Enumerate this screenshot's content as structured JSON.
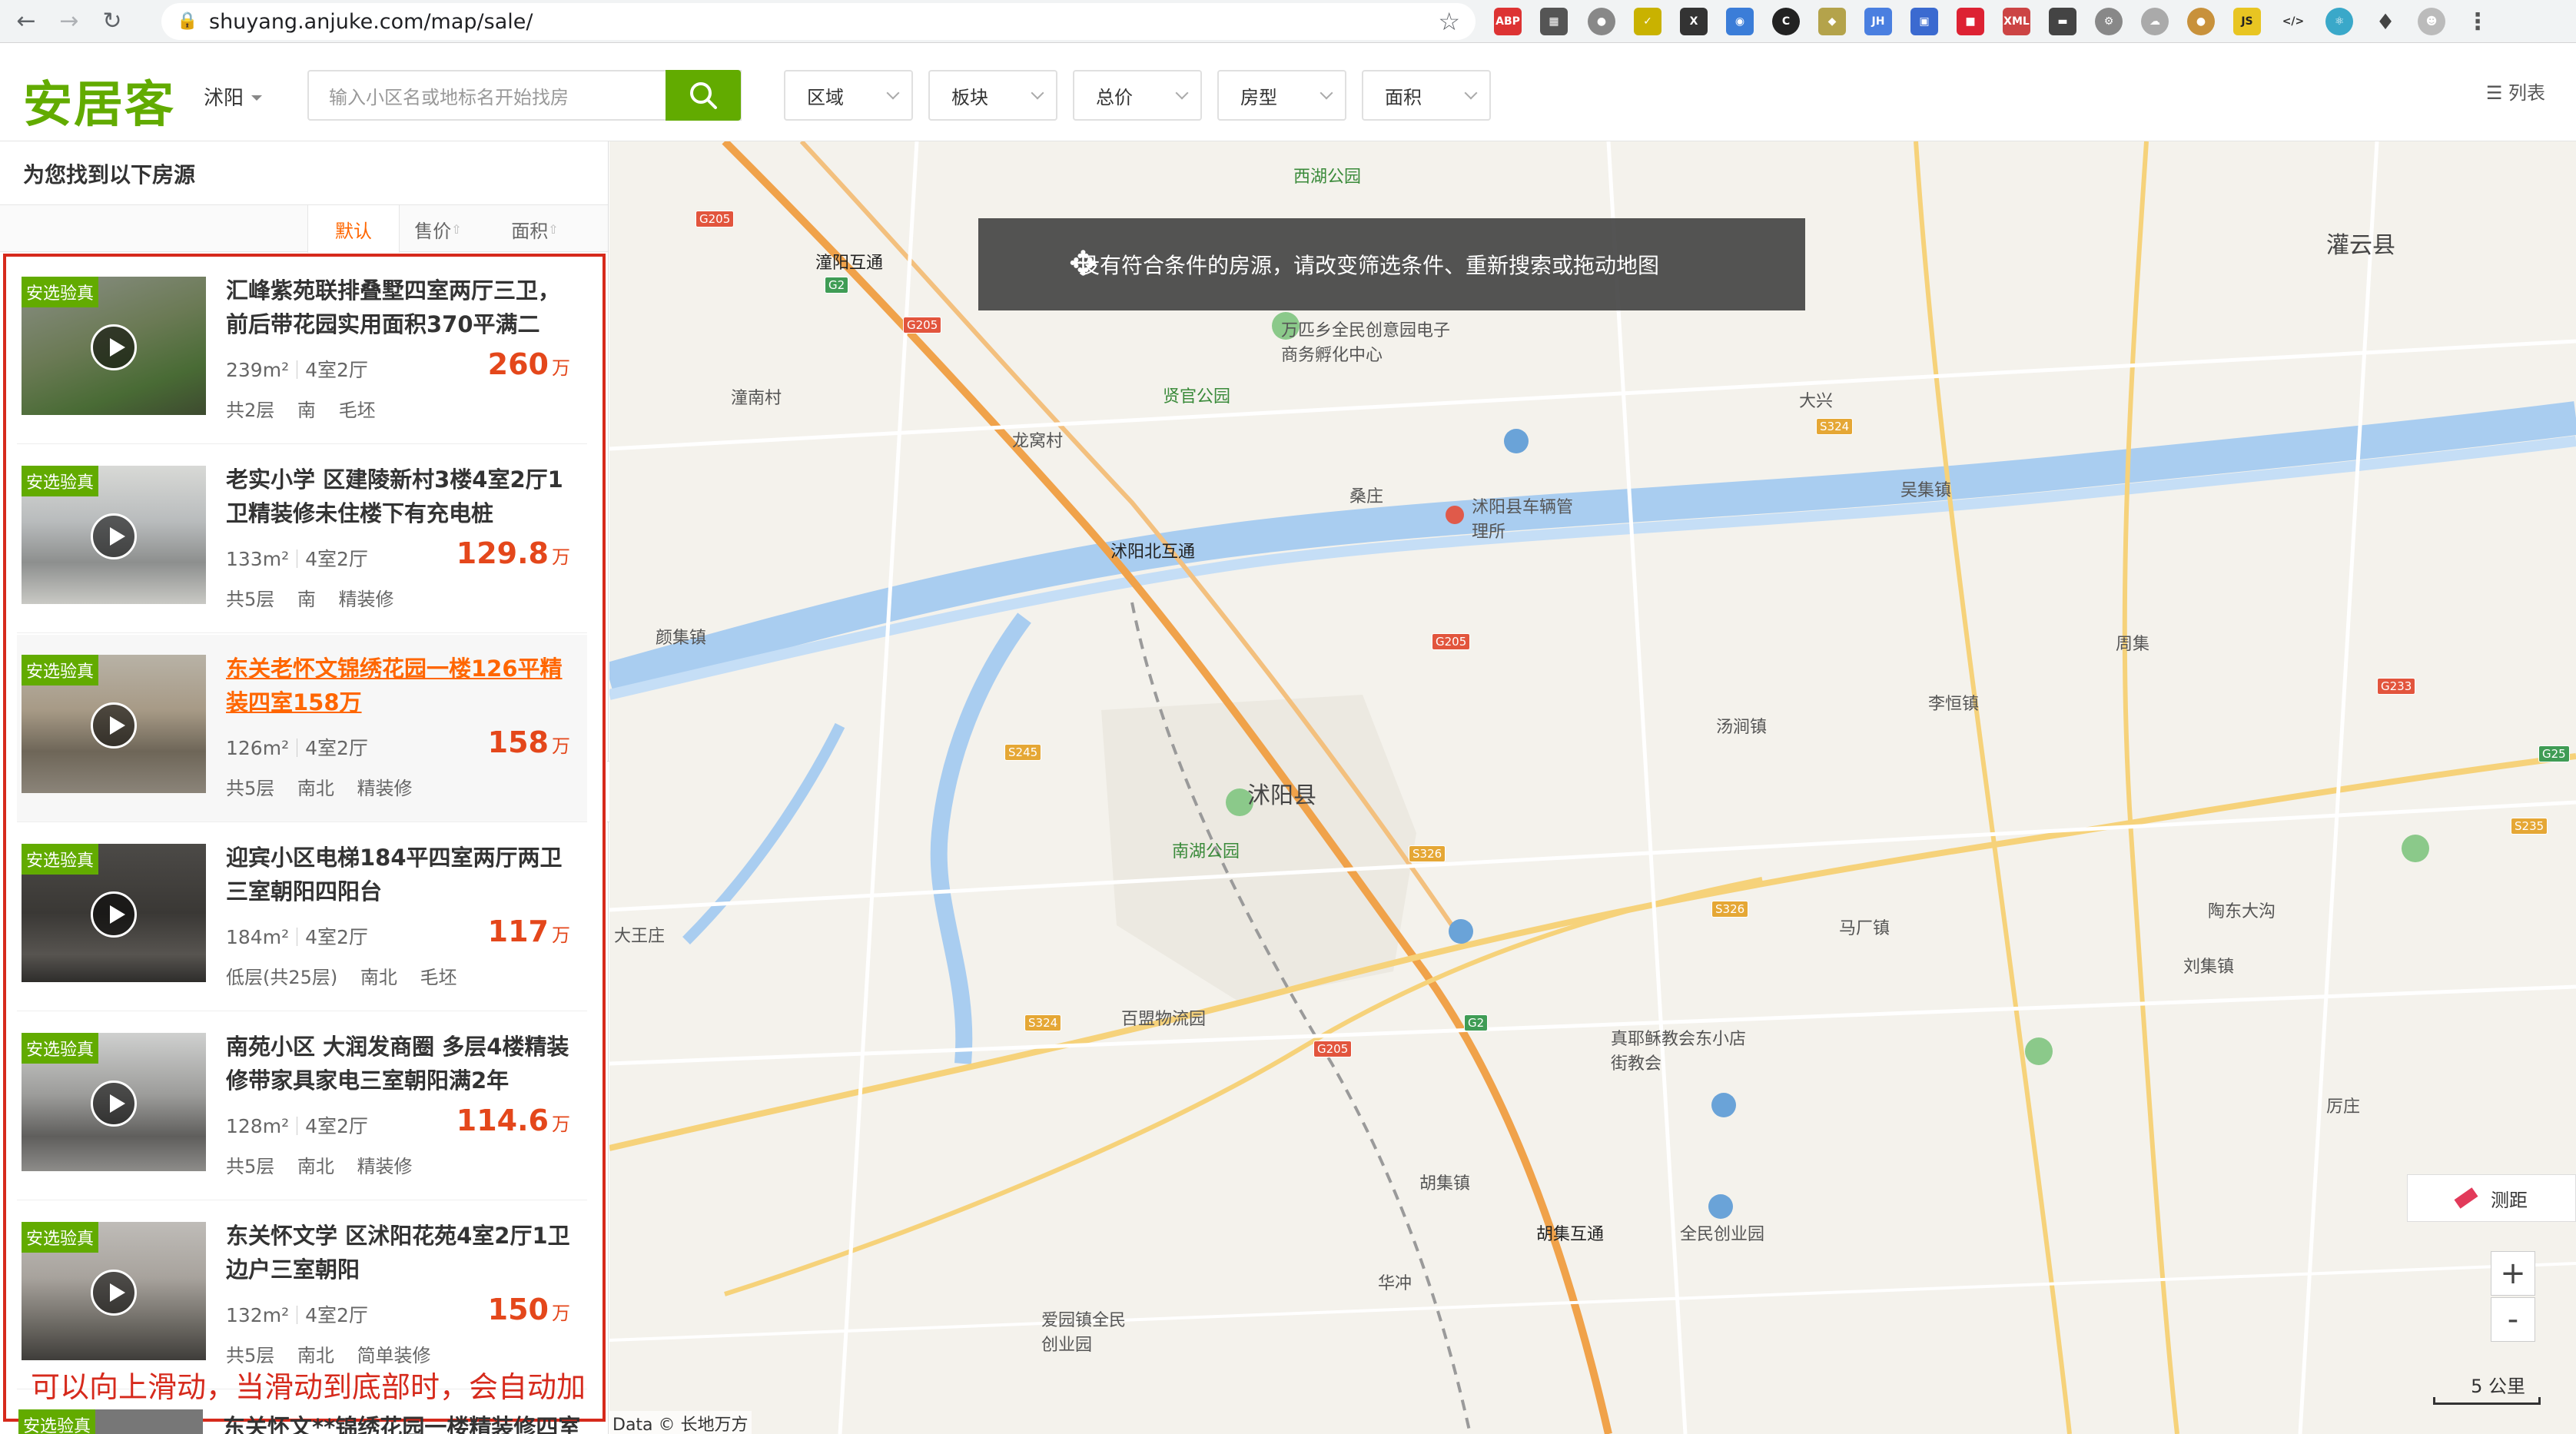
{
  "browser": {
    "url": "shuyang.anjuke.com/map/sale/"
  },
  "header": {
    "logo": "安居客",
    "city": "沭阳",
    "search_placeholder": "输入小区名或地标名开始找房",
    "filters": [
      "区域",
      "板块",
      "总价",
      "房型",
      "面积"
    ],
    "list_view": "列表"
  },
  "panel": {
    "found_text": "为您找到以下房源",
    "sort_options": [
      "默认",
      "售价",
      "面积"
    ],
    "listings": [
      {
        "badge": "安选验真",
        "title": "汇峰紫苑联排叠墅四室两厅三卫，前后带花园实用面积370平满二",
        "area": "239m²",
        "layout": "4室2厅",
        "price": "260",
        "unit": "万",
        "floor": "共2层",
        "orientation": "南",
        "decoration": "毛坯"
      },
      {
        "badge": "安选验真",
        "title": "老实小学 区建陵新村3楼4室2厅1卫精装修未住楼下有充电桩",
        "area": "133m²",
        "layout": "4室2厅",
        "price": "129.8",
        "unit": "万",
        "floor": "共5层",
        "orientation": "南",
        "decoration": "精装修"
      },
      {
        "badge": "安选验真",
        "title": "东关老怀文锦绣花园一楼126平精装四室158万",
        "area": "126m²",
        "layout": "4室2厅",
        "price": "158",
        "unit": "万",
        "floor": "共5层",
        "orientation": "南北",
        "decoration": "精装修"
      },
      {
        "badge": "安选验真",
        "title": "迎宾小区电梯184平四室两厅两卫 三室朝阳四阳台",
        "area": "184m²",
        "layout": "4室2厅",
        "price": "117",
        "unit": "万",
        "floor": "低层(共25层)",
        "orientation": "南北",
        "decoration": "毛坯"
      },
      {
        "badge": "安选验真",
        "title": "南苑小区 大润发商圈 多层4楼精装修带家具家电三室朝阳满2年",
        "area": "128m²",
        "layout": "4室2厅",
        "price": "114.6",
        "unit": "万",
        "floor": "共5层",
        "orientation": "南北",
        "decoration": "精装修"
      },
      {
        "badge": "安选验真",
        "title": "东关怀文学 区沭阳花苑4室2厅1卫边户三室朝阳",
        "area": "132m²",
        "layout": "4室2厅",
        "price": "150",
        "unit": "万",
        "floor": "共5层",
        "orientation": "南北",
        "decoration": "简单装修"
      }
    ],
    "partial_next": "东关怀文**锦绣花园一楼精装修四室两",
    "scroll_note": "可以向上滑动，当滑动到底部时，会自动加载"
  },
  "map": {
    "toast": "没有符合条件的房源，请改变筛选条件、重新搜索或拖动地图",
    "measure_label": "测距",
    "zoom_in": "+",
    "zoom_out": "-",
    "scale_label": "5 公里",
    "copyright": "Data © 长地万方",
    "labels": {
      "l1": "沭阳县",
      "l2": "沭阳北互通",
      "l3": "潼阳互通",
      "l4": "灌云县",
      "l5": "西湖公园",
      "l6": "贤官公园",
      "l7": "南湖公园",
      "l8": "百盟物流园",
      "l9": "陶东大沟",
      "l10": "胡集互通",
      "l11": "全民创业园",
      "l12": "爱园镇全民创业园",
      "l13": "真耶稣教会东小店街教会",
      "l14": "沭阳县车辆管理所",
      "l15": "万匹乡全民创意园电子商务孵化中心",
      "l16": "颜集镇",
      "l17": "汤涧镇",
      "l18": "马厂镇",
      "l19": "胡集镇",
      "l20": "李恒镇",
      "l21": "吴集镇",
      "l22": "刘集镇",
      "l23": "大王庄",
      "l24": "周集",
      "l25": "桑庄",
      "l26": "龙窝村",
      "l27": "潼南村",
      "l28": "大兴",
      "l29": "华冲",
      "l30": "厉庄"
    },
    "roads": [
      "G205",
      "G2",
      "S324",
      "S245",
      "S326",
      "G233",
      "G25",
      "S235"
    ]
  }
}
